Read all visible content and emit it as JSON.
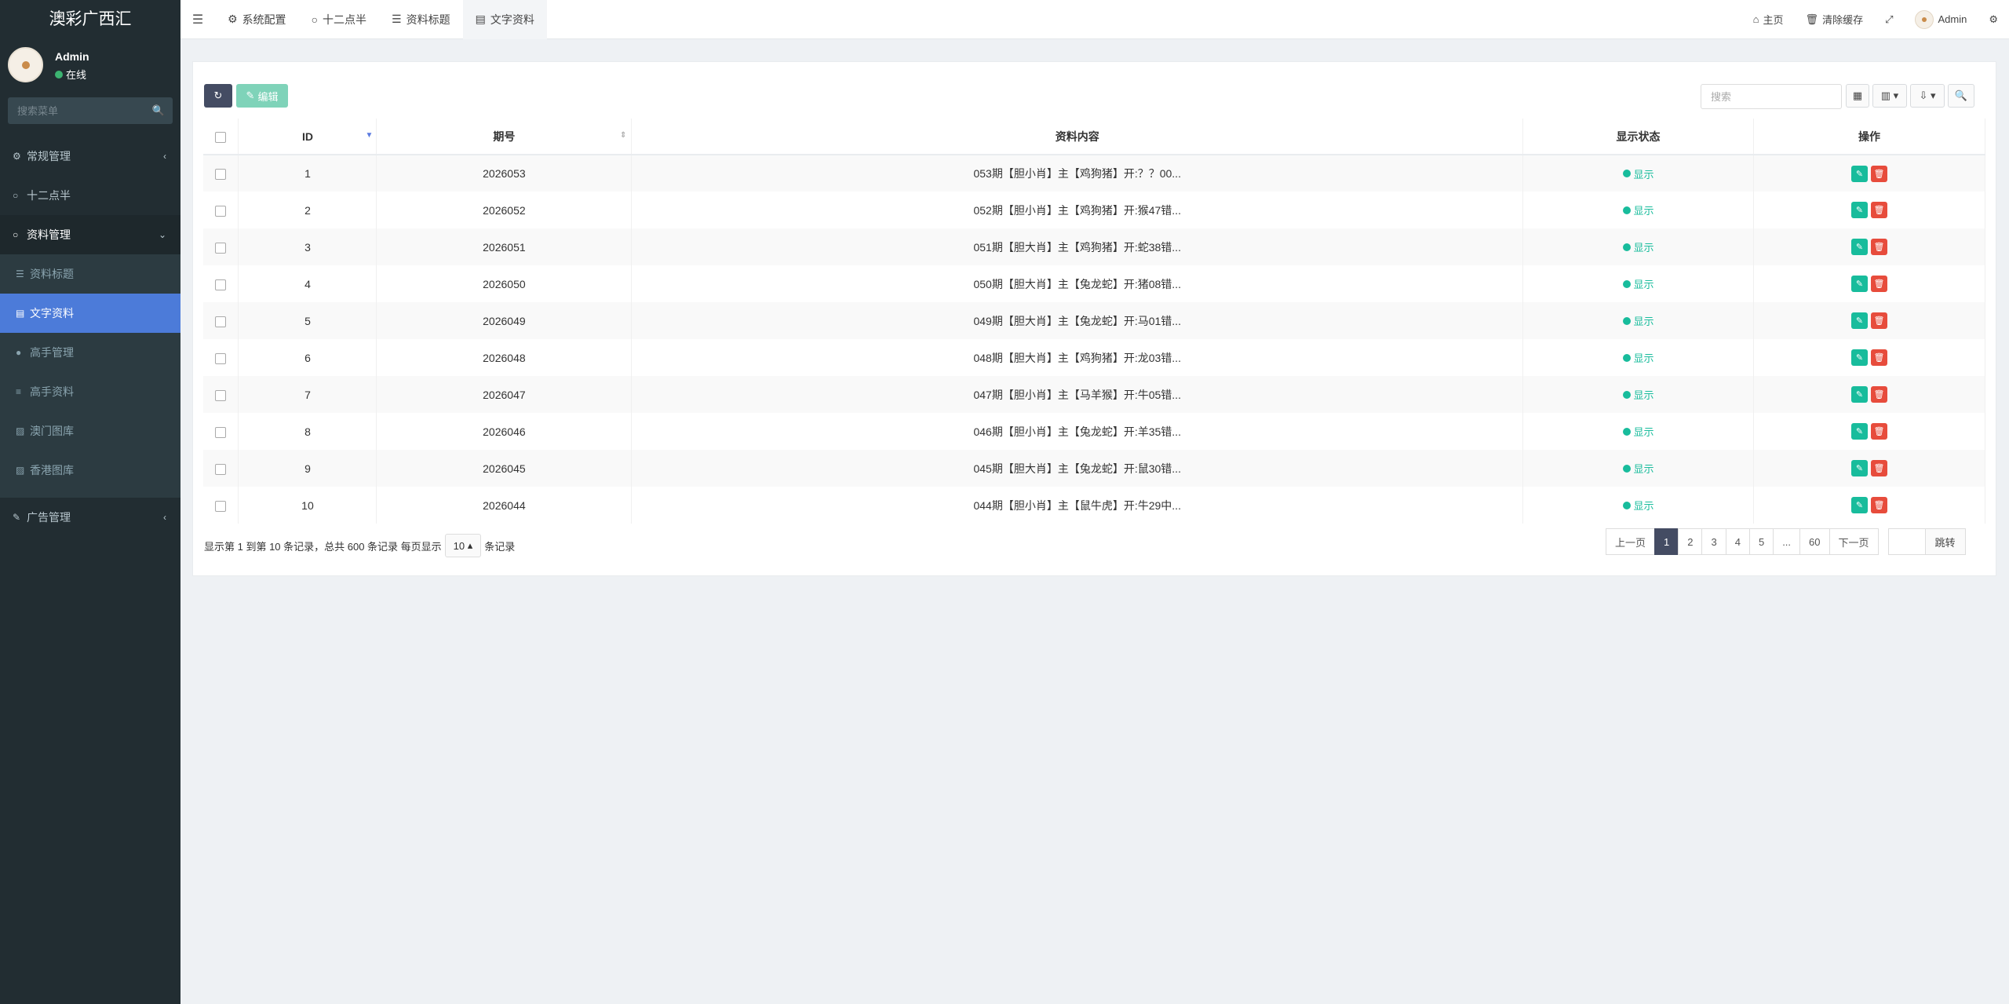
{
  "sidebar": {
    "logo": "澳彩广西汇",
    "user": {
      "name": "Admin",
      "status": "在线"
    },
    "search_placeholder": "搜索菜单",
    "menu": [
      {
        "label": "常规管理",
        "icon": "cogs-icon",
        "arrow": "‹"
      },
      {
        "label": "十二点半",
        "icon": "circle-icon"
      },
      {
        "label": "资料管理",
        "icon": "circle-icon",
        "arrow": "⌄"
      },
      {
        "label": "资料标题",
        "icon": "list-icon"
      },
      {
        "label": "文字资料",
        "icon": "file-icon"
      },
      {
        "label": "高手管理",
        "icon": "user-icon"
      },
      {
        "label": "高手资料",
        "icon": "database-icon"
      },
      {
        "label": "澳门图库",
        "icon": "image-icon"
      },
      {
        "label": "香港图库",
        "icon": "image-icon"
      },
      {
        "label": "广告管理",
        "icon": "bullhorn-icon",
        "arrow": "‹"
      }
    ]
  },
  "topbar": {
    "tabs": [
      "系统配置",
      "十二点半",
      "资料标题",
      "文字资料"
    ],
    "home": "主页",
    "clear_cache": "清除缓存",
    "admin": "Admin"
  },
  "toolbar": {
    "edit_label": "编辑",
    "search_placeholder": "搜索"
  },
  "table": {
    "headers": [
      "ID",
      "期号",
      "资料内容",
      "显示状态",
      "操作"
    ],
    "rows": [
      {
        "id": "1",
        "period": "2026053",
        "content": "053期【胆小肖】主【鸡狗猪】开:？？00...",
        "status": "显示"
      },
      {
        "id": "2",
        "period": "2026052",
        "content": "052期【胆小肖】主【鸡狗猪】开:猴47错...",
        "status": "显示"
      },
      {
        "id": "3",
        "period": "2026051",
        "content": "051期【胆大肖】主【鸡狗猪】开:蛇38错...",
        "status": "显示"
      },
      {
        "id": "4",
        "period": "2026050",
        "content": "050期【胆大肖】主【兔龙蛇】开:猪08错...",
        "status": "显示"
      },
      {
        "id": "5",
        "period": "2026049",
        "content": "049期【胆大肖】主【兔龙蛇】开:马01错...",
        "status": "显示"
      },
      {
        "id": "6",
        "period": "2026048",
        "content": "048期【胆大肖】主【鸡狗猪】开:龙03错...",
        "status": "显示"
      },
      {
        "id": "7",
        "period": "2026047",
        "content": "047期【胆小肖】主【马羊猴】开:牛05错...",
        "status": "显示"
      },
      {
        "id": "8",
        "period": "2026046",
        "content": "046期【胆小肖】主【兔龙蛇】开:羊35错...",
        "status": "显示"
      },
      {
        "id": "9",
        "period": "2026045",
        "content": "045期【胆大肖】主【兔龙蛇】开:鼠30错...",
        "status": "显示"
      },
      {
        "id": "10",
        "period": "2026044",
        "content": "044期【胆小肖】主【鼠牛虎】开:牛29中...",
        "status": "显示"
      }
    ]
  },
  "footer": {
    "summary": "显示第 1 到第 10 条记录，总共 600 条记录 每页显示",
    "page_size": "10",
    "suffix": "条记录",
    "pager": {
      "prev": "上一页",
      "pages": [
        "1",
        "2",
        "3",
        "4",
        "5",
        "...",
        "60"
      ],
      "next": "下一页",
      "jump": "跳转"
    }
  }
}
